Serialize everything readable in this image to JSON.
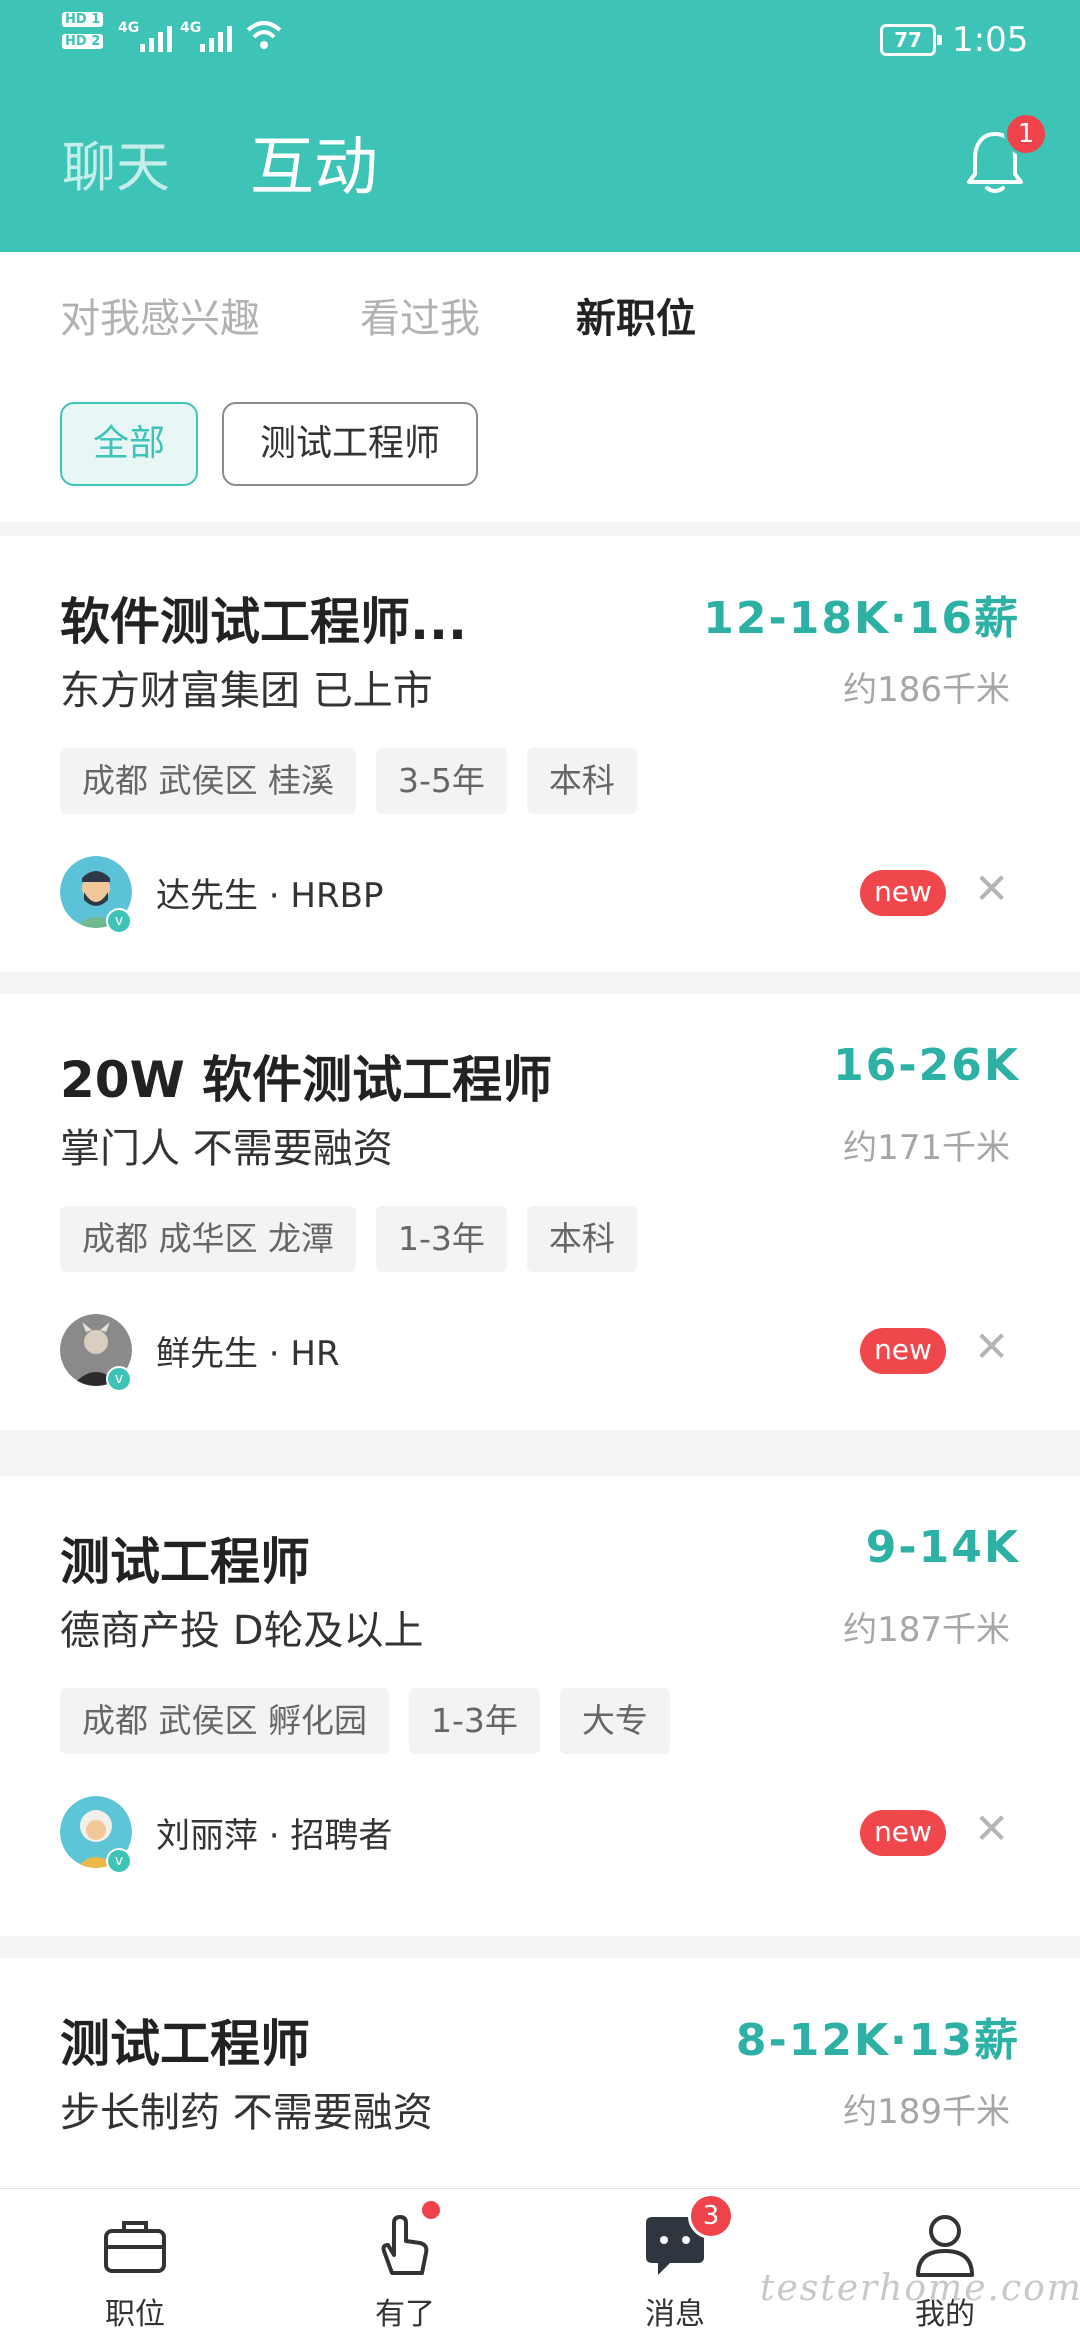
{
  "status_bar": {
    "hd1": "HD 1",
    "hd2": "HD 2",
    "signal1": "4G",
    "signal2": "4G",
    "battery": "77",
    "time": "1:05"
  },
  "header": {
    "tab_chat": "聊天",
    "tab_interact": "互动",
    "notification_count": "1"
  },
  "subtabs": [
    "对我感兴趣",
    "看过我",
    "新职位"
  ],
  "filters": [
    "全部",
    "测试工程师"
  ],
  "jobs": [
    {
      "title": "软件测试工程师...",
      "salary": "12-18K·16薪",
      "company": "东方财富集团  已上市",
      "distance": "约186千米",
      "tags": [
        "成都 武侯区 桂溪",
        "3-5年",
        "本科"
      ],
      "recruiter": "达先生 · HRBP",
      "new_label": "new"
    },
    {
      "title": "20W 软件测试工程师",
      "salary": "16-26K",
      "company": "掌门人  不需要融资",
      "distance": "约171千米",
      "tags": [
        "成都 成华区 龙潭",
        "1-3年",
        "本科"
      ],
      "recruiter": "鲜先生 · HR",
      "new_label": "new"
    },
    {
      "title": "测试工程师",
      "salary": "9-14K",
      "company": "德商产投  D轮及以上",
      "distance": "约187千米",
      "tags": [
        "成都 武侯区 孵化园",
        "1-3年",
        "大专"
      ],
      "recruiter": "刘丽萍 · 招聘者",
      "new_label": "new"
    },
    {
      "title": "测试工程师",
      "salary": "8-12K·13薪",
      "company": "步长制药  不需要融资",
      "distance": "约189千米"
    }
  ],
  "nav": {
    "items": [
      {
        "label": "职位",
        "icon": "briefcase-icon"
      },
      {
        "label": "有了",
        "icon": "heart-hand-icon"
      },
      {
        "label": "消息",
        "icon": "chat-bubble-icon",
        "count": "3"
      },
      {
        "label": "我的",
        "icon": "user-icon"
      }
    ]
  },
  "watermark": "testerhome.com",
  "colors": {
    "brand": "#3ec3b7",
    "salary": "#2cb1a4",
    "alert": "#f0424a"
  }
}
